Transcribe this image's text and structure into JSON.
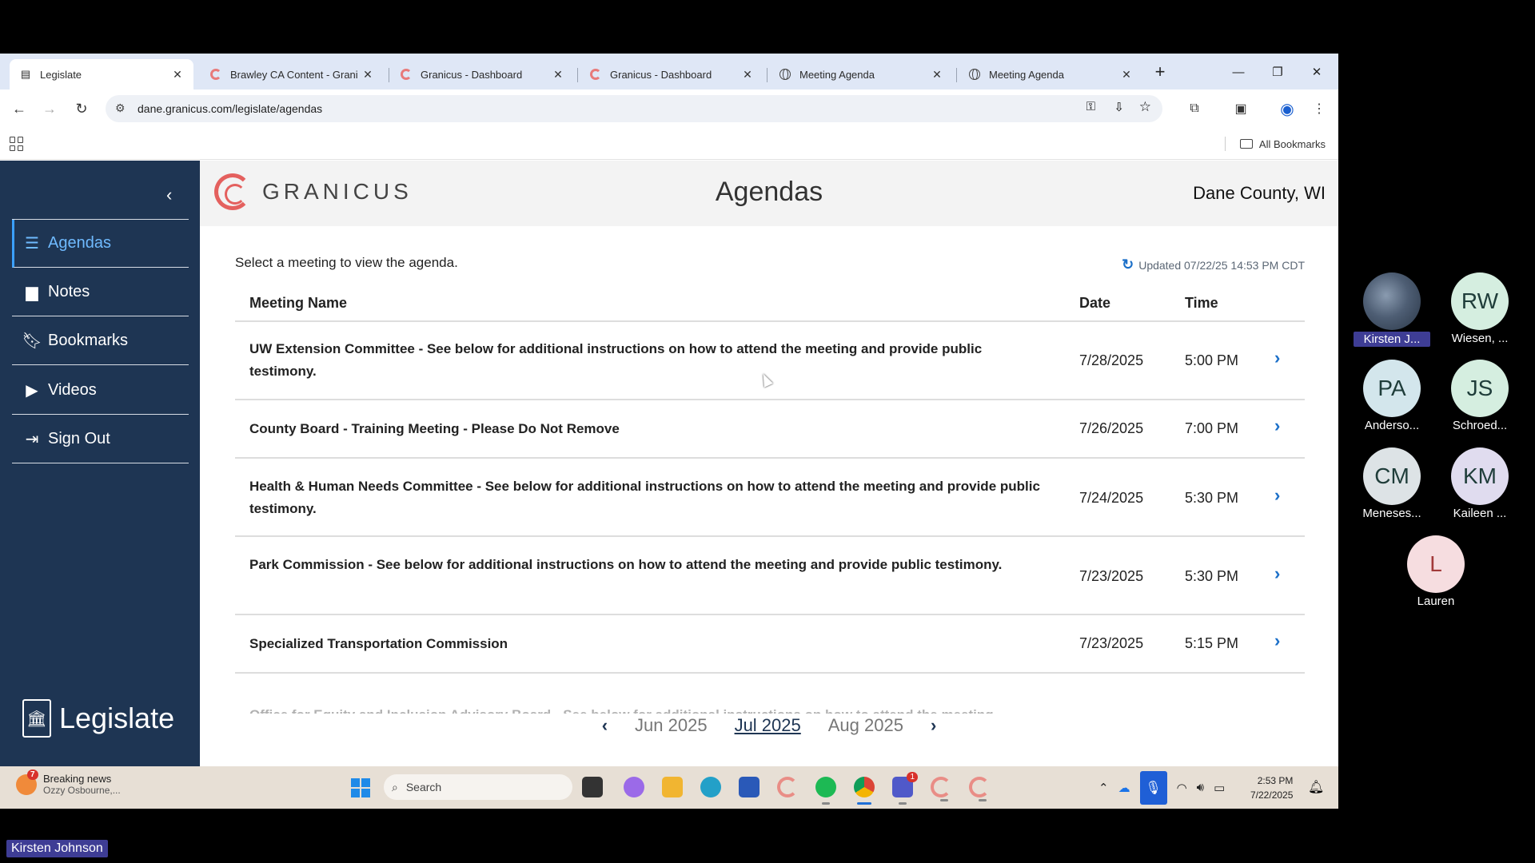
{
  "browser": {
    "tabs": [
      {
        "title": "Legislate",
        "icon": "page-icon",
        "active": true
      },
      {
        "title": "Brawley CA Content - Grani",
        "icon": "granicus-icon"
      },
      {
        "title": "Granicus - Dashboard",
        "icon": "granicus-icon"
      },
      {
        "title": "Granicus - Dashboard",
        "icon": "granicus-icon"
      },
      {
        "title": "Meeting Agenda",
        "icon": "globe-icon"
      },
      {
        "title": "Meeting Agenda",
        "icon": "globe-icon"
      }
    ],
    "url": "dane.granicus.com/legislate/agendas",
    "all_bookmarks": "All Bookmarks"
  },
  "app": {
    "sidebar": {
      "items": [
        {
          "label": "Agendas",
          "icon": "list-icon",
          "active": true
        },
        {
          "label": "Notes",
          "icon": "note-icon"
        },
        {
          "label": "Bookmarks",
          "icon": "bookmark-icon"
        },
        {
          "label": "Videos",
          "icon": "play-icon"
        },
        {
          "label": "Sign Out",
          "icon": "sign-out-icon"
        }
      ],
      "brand": "Legislate"
    },
    "header": {
      "logo_text": "GRANICUS",
      "title": "Agendas",
      "org": "Dane County, WI"
    },
    "instruction": "Select a meeting to view the agenda.",
    "updated": "Updated 07/22/25 14:53 PM CDT",
    "columns": {
      "name": "Meeting Name",
      "date": "Date",
      "time": "Time"
    },
    "meetings": [
      {
        "name": "UW Extension Committee - See below for additional instructions on how to attend the meeting and provide public testimony.",
        "date": "7/28/2025",
        "time": "5:00 PM"
      },
      {
        "name": "County Board - Training Meeting - Please Do Not Remove",
        "date": "7/26/2025",
        "time": "7:00 PM"
      },
      {
        "name": "Health & Human Needs Committee - See below for additional instructions on how to attend the meeting and provide public testimony.",
        "date": "7/24/2025",
        "time": "5:30 PM"
      },
      {
        "name": "Park Commission - See below for additional instructions on how to attend the meeting and provide public testimony.",
        "date": "7/23/2025",
        "time": "5:30 PM"
      },
      {
        "name": "Specialized Transportation Commission",
        "date": "7/23/2025",
        "time": "5:15 PM"
      }
    ],
    "partial_row": "Office for Equity and Inclusion Advisory Board - See below for additional instructions on how to attend the meeting",
    "month_nav": {
      "prev": "Jun 2025",
      "current": "Jul 2025",
      "next": "Aug 2025"
    }
  },
  "taskbar": {
    "news_title": "Breaking news",
    "news_sub": "Ozzy Osbourne,...",
    "news_badge": "7",
    "search": "Search",
    "teams_badge": "1",
    "time": "2:53 PM",
    "date": "7/22/2025"
  },
  "participants": [
    {
      "initials": "",
      "name": "Kirsten J...",
      "photo": true,
      "highlight": true
    },
    {
      "initials": "RW",
      "name": "Wiesen, ...",
      "color": "#d5eee0"
    },
    {
      "initials": "PA",
      "name": "Anderso...",
      "color": "#d3e6ec"
    },
    {
      "initials": "JS",
      "name": "Schroed...",
      "color": "#d5eee0"
    },
    {
      "initials": "CM",
      "name": "Meneses...",
      "color": "#dde3e6"
    },
    {
      "initials": "KM",
      "name": "Kaileen ...",
      "color": "#e0dcef"
    },
    {
      "initials": "L",
      "name": "Lauren",
      "color": "#f6dde0"
    }
  ],
  "self_label": "Kirsten Johnson"
}
